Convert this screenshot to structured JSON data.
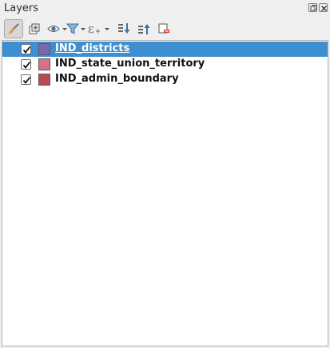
{
  "panel": {
    "title": "Layers"
  },
  "toolbar": {
    "buttons": [
      {
        "icon": "style-brush-icon",
        "tooltip": ""
      },
      {
        "icon": "add-group-icon",
        "tooltip": ""
      },
      {
        "icon": "eye-visibility-icon",
        "tooltip": ""
      },
      {
        "icon": "filter-funnel-icon",
        "tooltip": ""
      },
      {
        "icon": "expression-filter-icon",
        "tooltip": ""
      },
      {
        "icon": "expand-all-icon",
        "tooltip": ""
      },
      {
        "icon": "collapse-all-icon",
        "tooltip": ""
      },
      {
        "icon": "remove-layer-icon",
        "tooltip": ""
      }
    ]
  },
  "layers": [
    {
      "name": "IND_districts",
      "checked": true,
      "color": "#7b68b0",
      "selected": true
    },
    {
      "name": "IND_state_union_territory",
      "checked": true,
      "color": "#d9708a",
      "selected": false
    },
    {
      "name": "IND_admin_boundary",
      "checked": true,
      "color": "#b84a50",
      "selected": false
    }
  ],
  "colors": {
    "selection": "#3d8fd1",
    "panel_bg": "#efefef",
    "tree_bg": "#ffffff"
  }
}
